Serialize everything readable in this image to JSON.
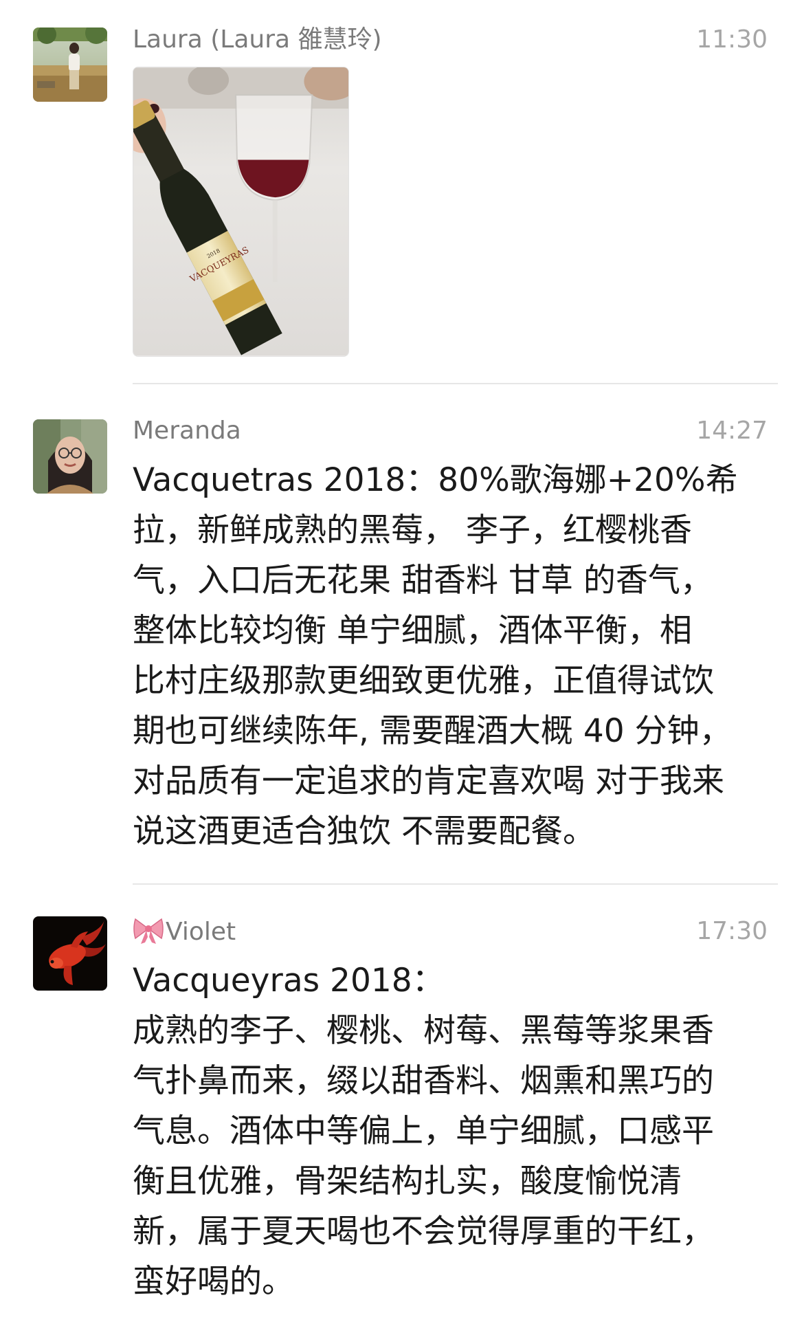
{
  "posts": [
    {
      "author": "Laura (Laura 雒慧玲)",
      "time": "11:30",
      "avatar_icon": "avatar-photo-field-icon",
      "photo_icon": "wine-bottle-and-glass-photo"
    },
    {
      "author": "Meranda",
      "time": "14:27",
      "avatar_icon": "avatar-photo-woman-glasses-icon",
      "text": "Vacquetras 2018：80%歌海娜+20%希\n拉，新鲜成熟的黑莓， 李子，红樱桃香\n气，入口后无花果 甜香料  甘草 的香气，\n整体比较均衡  单宁细腻，酒体平衡，相\n比村庄级那款更细致更优雅，正值得试饮\n期也可继续陈年, 需要醒酒大概 40 分钟，\n对品质有一定追求的肯定喜欢喝 对于我来\n说这酒更适合独饮 不需要配餐。"
    },
    {
      "author_emoji_icon": "ribbon-bow-icon",
      "author": "Violet",
      "time": "17:30",
      "avatar_icon": "avatar-goldfish-icon",
      "text": "Vacqueyras 2018：\n成熟的李子、樱桃、树莓、黑莓等浆果香\n气扑鼻而来，缀以甜香料、烟熏和黑巧的\n气息。酒体中等偏上，单宁细腻，口感平\n衡且优雅，骨架结构扎实，酸度愉悦清\n新，属于夏天喝也不会觉得厚重的干红，\n蛮好喝的。"
    }
  ],
  "colors": {
    "name": "#7a7a7a",
    "time": "#a6a6a6",
    "text": "#1a1a1a",
    "divider": "#e6e6e6"
  }
}
